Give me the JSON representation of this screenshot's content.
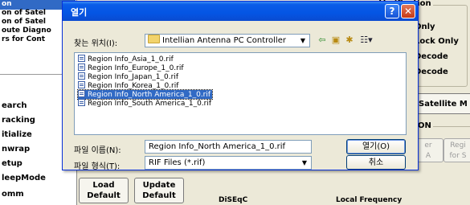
{
  "background": {
    "tree_items": [
      "on",
      "on of Satel",
      "on of Satel",
      "oute Diagno",
      "rs for Cont"
    ],
    "commands": [
      "earch",
      "racking",
      "itialize",
      "nwrap",
      "etup",
      "leepMode",
      "omm"
    ],
    "verification": {
      "legend": "Verification",
      "items": [
        "Only",
        "Lock Only",
        "Decode",
        "Decode"
      ]
    },
    "satellite_button": "Satellite M",
    "on_group_label": "ON",
    "dim_buttons": [
      {
        "line1": "er",
        "line2": "A"
      },
      {
        "line1": "Regi",
        "line2": "for S"
      }
    ],
    "load_default": {
      "line1": "Load",
      "line2": "Default"
    },
    "update_default": {
      "line1": "Update",
      "line2": "Default"
    },
    "bottom_labels": [
      "DiSEqC",
      "Local Frequency"
    ]
  },
  "dialog": {
    "title": "열기",
    "help_glyph": "?",
    "close_glyph": "✕",
    "lookin_label": "찾는 위치(I):",
    "lookin_value": "Intellian Antenna PC Controller",
    "files": [
      "Region Info_Asia_1_0.rif",
      "Region Info_Europe_1_0.rif",
      "Region Info_Japan_1_0.rif",
      "Region Info_Korea_1_0.rif",
      "Region Info_North America_1_0.rif",
      "Region Info_South America_1_0.rif"
    ],
    "selected_index": 4,
    "filename_label": "파일 이름(N):",
    "filename_value": "Region Info_North America_1_0.rif",
    "filetype_label": "파일 형식(T):",
    "filetype_value": "RIF Files (*.rif)",
    "open_button": "열기(O)",
    "cancel_button": "취소"
  }
}
